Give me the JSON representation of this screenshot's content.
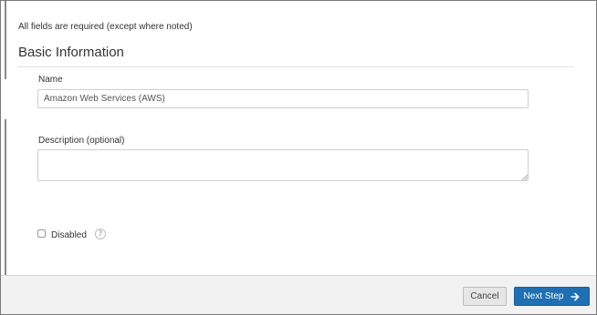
{
  "form": {
    "required_note": "All fields are required (except where noted)",
    "section_title": "Basic Information",
    "name_label": "Name",
    "name_value": "Amazon Web Services (AWS)",
    "description_label": "Description (optional)",
    "description_value": "",
    "disabled_label": "Disabled",
    "disabled_checked": false,
    "help_glyph": "?"
  },
  "footer": {
    "cancel_label": "Cancel",
    "next_label": "Next Step"
  },
  "icons": {
    "help": "help-icon",
    "next": "arrow-right-icon",
    "resize": "resize-grip-icon"
  },
  "colors": {
    "primary": "#1f6fb5",
    "footer_bg": "#f2f2f2"
  }
}
